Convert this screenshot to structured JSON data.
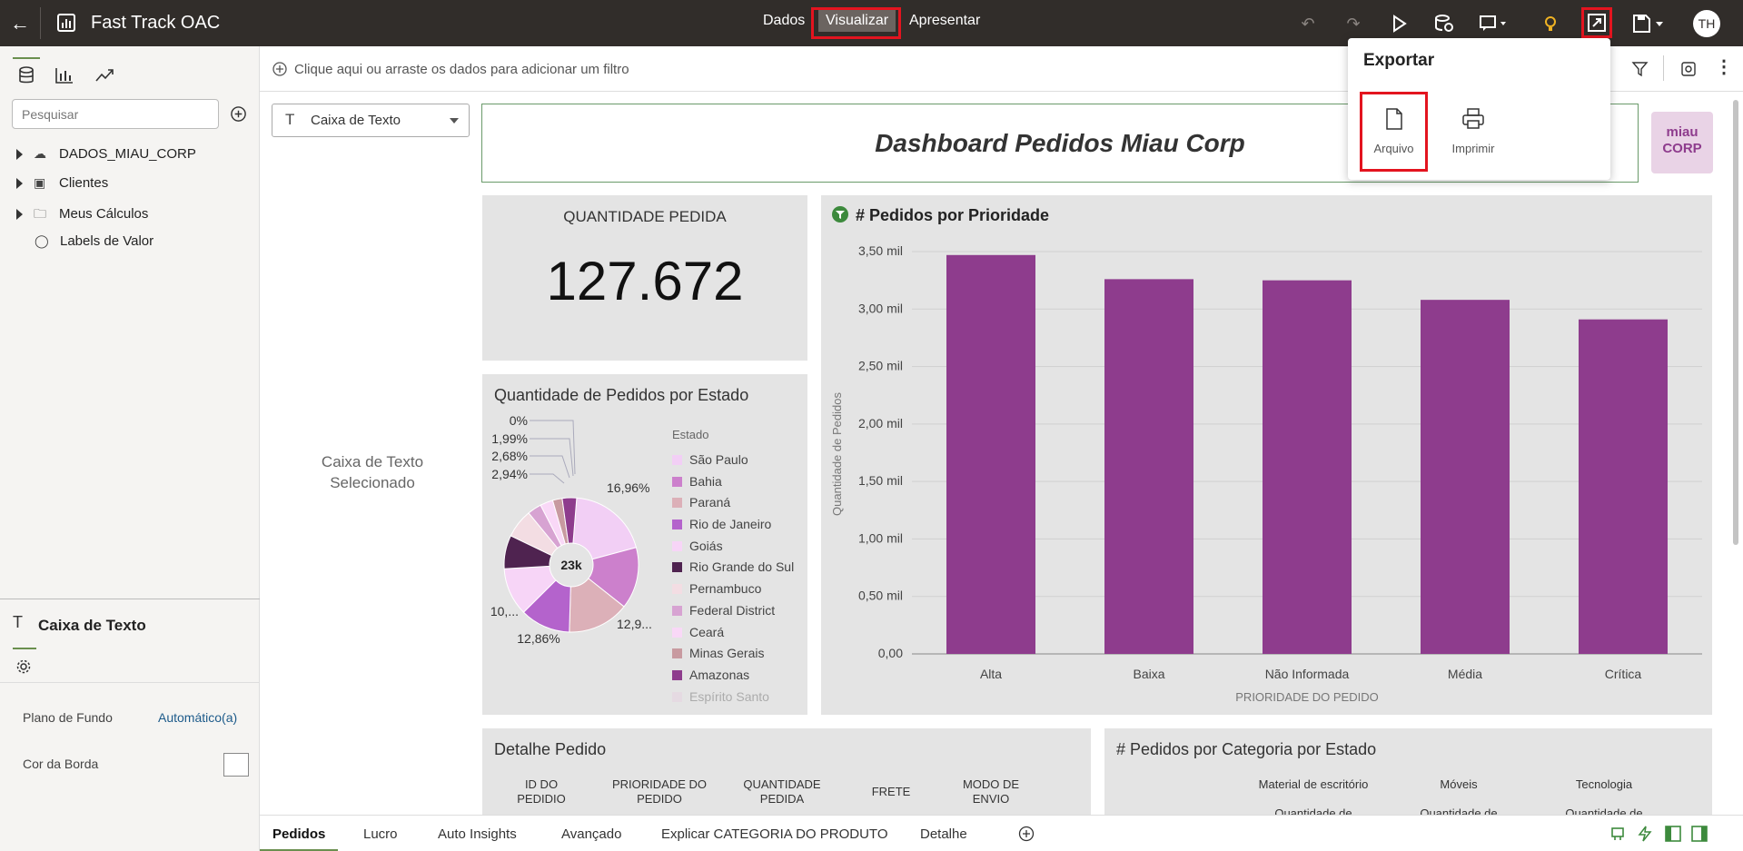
{
  "app": {
    "title": "Fast Track OAC"
  },
  "nav": {
    "tabs": [
      "Dados",
      "Visualizar",
      "Apresentar"
    ],
    "active": "Visualizar"
  },
  "user": {
    "initials": "TH"
  },
  "left_panel": {
    "search_placeholder": "Pesquisar",
    "tree": [
      "DADOS_MIAU_CORP",
      "Clientes",
      "Meus Cálculos",
      "Labels de Valor"
    ],
    "props": {
      "title": "Caixa de Texto",
      "fundo_label": "Plano de Fundo",
      "fundo_value": "Automático(a)",
      "borda_label": "Cor da Borda"
    }
  },
  "filter_bar": {
    "hint": "Clique aqui ou arraste os dados para adicionar um filtro"
  },
  "viz_select": {
    "value": "Caixa de Texto"
  },
  "selected_text": "Caixa de Texto\nSelecionado",
  "dashboard": {
    "title": "Dashboard Pedidos Miau Corp",
    "logo_text": "miau\nCORP"
  },
  "kpi": {
    "label": "QUANTIDADE PEDIDA",
    "value": "127.672"
  },
  "pie": {
    "title": "Quantidade de Pedidos por Estado",
    "center": "23k",
    "legend_title": "Estado",
    "labels": [
      "0%",
      "1,99%",
      "2,68%",
      "2,94%",
      "16,96%",
      "12,9...",
      "12,86%",
      "10,..."
    ]
  },
  "detail": {
    "title": "Detalhe Pedido",
    "columns": [
      "ID DO\nPEDIDIO",
      "PRIORIDADE DO\nPEDIDO",
      "QUANTIDADE\nPEDIDA",
      "FRETE",
      "MODO DE\nENVIO"
    ]
  },
  "category": {
    "title": "# Pedidos por Categoria por Estado",
    "columns": [
      "Material de escritório",
      "Móveis",
      "Tecnologia"
    ],
    "subheader": "Quantidade de"
  },
  "popup": {
    "title": "Exportar",
    "items": [
      "Arquivo",
      "Imprimir"
    ]
  },
  "bottom_tabs": [
    "Pedidos",
    "Lucro",
    "Auto Insights",
    "Avançado",
    "Explicar CATEGORIA DO PRODUTO",
    "Detalhe"
  ],
  "colors": {
    "bar": "#8e3c8d",
    "topbar": "#312d2a",
    "highlight": "#e3141f"
  },
  "chart_data": [
    {
      "type": "bar",
      "title": "# Pedidos por Prioridade",
      "xlabel": "PRIORIDADE DO PEDIDO",
      "ylabel": "Quantidade de Pedidos",
      "categories": [
        "Alta",
        "Baixa",
        "Não Informada",
        "Média",
        "Crítica"
      ],
      "values": [
        3470,
        3260,
        3250,
        3080,
        2910
      ],
      "ylim": [
        0,
        3500
      ],
      "yticks": [
        "0,00",
        "0,50 mil",
        "1,00 mil",
        "1,50 mil",
        "2,00 mil",
        "2,50 mil",
        "3,00 mil",
        "3,50 mil"
      ],
      "grid": true
    },
    {
      "type": "pie",
      "title": "Quantidade de Pedidos por Estado",
      "categories": [
        "São Paulo",
        "Bahia",
        "Paraná",
        "Rio de Janeiro",
        "Goiás",
        "Rio Grande do Sul",
        "Pernambuco",
        "Federal District",
        "Ceará",
        "Minas Gerais",
        "Amazonas",
        "Espírito Santo"
      ],
      "values": [
        16.96,
        12.9,
        12.86,
        10.5,
        10,
        7,
        6,
        2.94,
        2.68,
        1.99,
        3,
        0
      ],
      "colors": [
        "#f2cff5",
        "#cc80cc",
        "#dcb0b8",
        "#b463cc",
        "#f7d5f7",
        "#4f2350",
        "#f3dde3",
        "#d7a3d2",
        "#f9d8f7",
        "#c89aa0",
        "#8e3c8d",
        "#e8c8e0"
      ]
    }
  ]
}
